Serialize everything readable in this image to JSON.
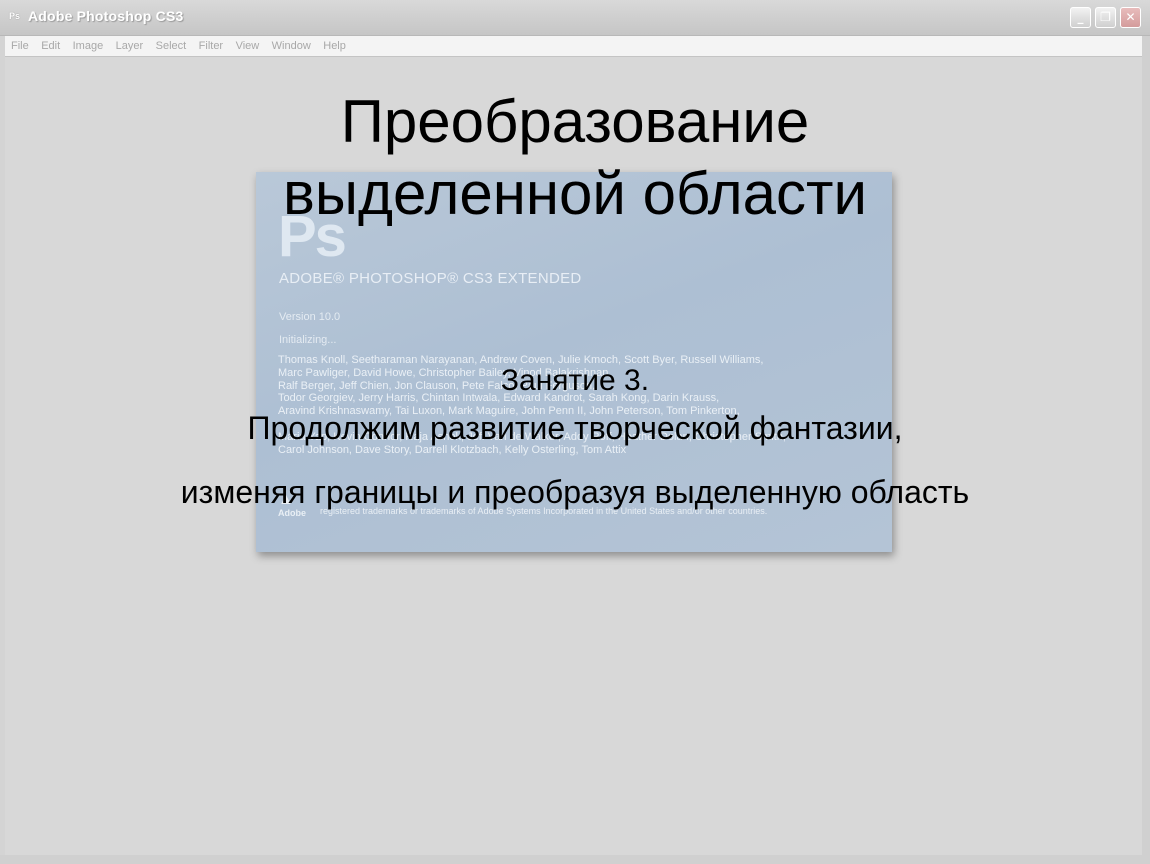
{
  "window": {
    "app_icon": "Ps",
    "title": "Adobe Photoshop CS3",
    "buttons": {
      "minimize": "_",
      "maximize": "❐",
      "close": "✕"
    }
  },
  "menubar": {
    "items": [
      "File",
      "Edit",
      "Image",
      "Layer",
      "Select",
      "Filter",
      "View",
      "Window",
      "Help"
    ]
  },
  "splash": {
    "logo": "Ps",
    "product": "ADOBE® PHOTOSHOP® CS3 EXTENDED",
    "version": "Version 10.0",
    "status": "Initializing...",
    "credits": [
      "Thomas Knoll, Seetharaman Narayanan, Andrew Coven, Julie Kmoch, Scott Byer, Russell Williams,",
      "Marc Pawliger, David Howe, Christopher Bailey, Vinod Balakrishnan,",
      "Ralf Berger, Jeff Chien, Jon Clauson, Pete Falco, Paul Ferguson,",
      "Todor Georgiev, Jerry Harris, Chintan Intwala, Edward Kandrot, Sarah Kong, Darin Krauss,",
      "Aravind Krishnaswamy, Tai Luxon, Mark Maguire, John Penn II, John Peterson, Tom Pinkerton,",
      "",
      "Maria Yap, Kevin Connor, Raja Ashok, Jeff Van de Walker, Addy Roff, Heather Dolan, Christopher Smith,",
      "Carol Johnson, Dave Story, Darrell Klotzbach, Kelly Osterling, Tom Attix"
    ],
    "adobe_label": "Adobe",
    "trademark": "registered trademarks or trademarks of Adobe Systems Incorporated in the United States and/or other countries."
  },
  "slide": {
    "title_line1": "Преобразование",
    "title_line2": "выделенной области",
    "lesson": "Занятие 3.",
    "subtitle_line1": "Продолжим развитие творческой фантазии,",
    "subtitle_line2": "изменяя границы и преобразуя выделенную область"
  }
}
